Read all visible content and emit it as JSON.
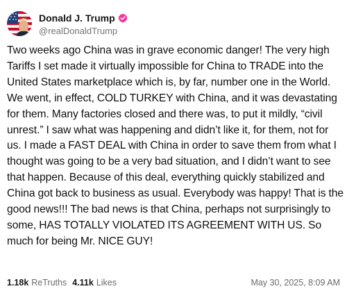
{
  "author": {
    "display_name": "Donald J. Trump",
    "handle": "@realDonaldTrump",
    "avatar_icon": "avatar-flag-icon",
    "verified_icon": "verified-badge-icon",
    "verified_color": "#f5339c"
  },
  "post": {
    "text": "Two weeks ago China was in grave economic danger! The very high Tariffs I set made it virtually impossible for China to TRADE into the United States marketplace which is, by far, number one in the World. We went, in effect, COLD TURKEY with China, and it was devastating for them. Many factories closed and there was, to put it mildly, “civil unrest.” I saw what was happening and didn’t like it, for them, not for us. I made a FAST DEAL with China in order to save them from what I thought was going to be a very bad situation, and I didn’t want to see that happen. Because of this deal, everything quickly stabilized and China got back to business as usual. Everybody was happy! That is the good news!!! The bad news is that China, perhaps not surprisingly to some, HAS TOTALLY VIOLATED ITS AGREEMENT WITH US. So much for being Mr. NICE GUY!"
  },
  "stats": {
    "retruths_count": "1.18k",
    "retruths_label": "ReTruths",
    "likes_count": "4.11k",
    "likes_label": "Likes"
  },
  "timestamp": "May 30, 2025, 8:09 AM"
}
